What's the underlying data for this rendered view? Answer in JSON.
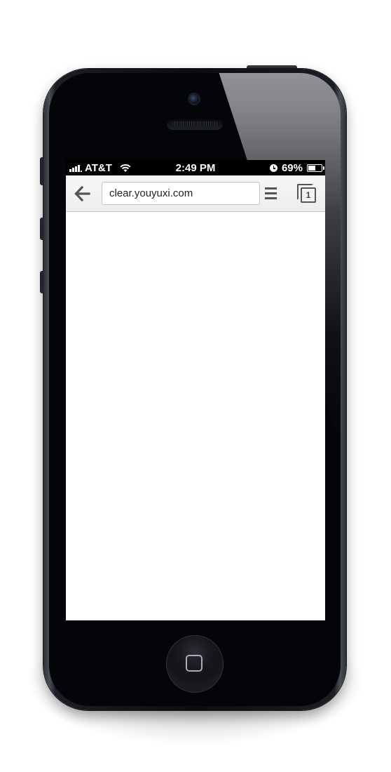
{
  "status_bar": {
    "carrier": "AT&T",
    "time": "2:49 PM",
    "battery_percent": "69%",
    "battery_level": 0.69,
    "icons": [
      "signal-bars-icon",
      "wifi-icon",
      "clock-icon",
      "battery-icon"
    ]
  },
  "toolbar": {
    "back_icon": "arrow-left-icon",
    "url": "clear.youyuxi.com",
    "menu_icon": "hamburger-menu-icon",
    "tab_count": "1",
    "tabs_icon": "tabs-icon"
  },
  "device": {
    "model": "iphone",
    "color": "black"
  }
}
